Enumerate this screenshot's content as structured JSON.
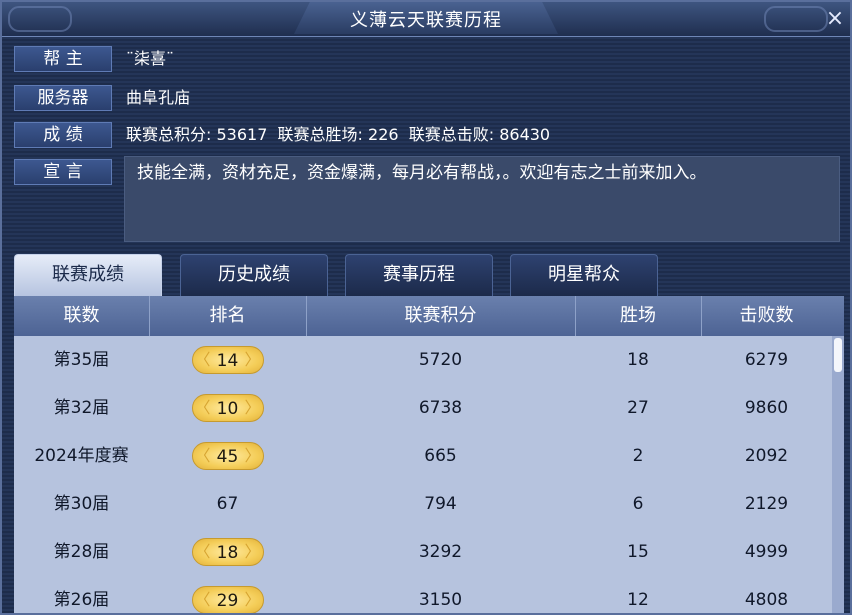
{
  "window": {
    "title": "义薄云天联赛历程",
    "close_icon": "×"
  },
  "info": {
    "leader_label": "帮 主",
    "leader_value": "¨柒喜¨",
    "server_label": "服务器",
    "server_value": "曲阜孔庙",
    "score_label": "成 绩",
    "score_value": "联赛总积分: 53617  联赛总胜场: 226  联赛总击败: 86430",
    "declaration_label": "宣 言",
    "declaration_value": "技能全满，资材充足，资金爆满，每月必有帮战，。欢迎有志之士前来加入。"
  },
  "tabs": [
    {
      "label": "联赛成绩",
      "active": true
    },
    {
      "label": "历史成绩",
      "active": false
    },
    {
      "label": "赛事历程",
      "active": false
    },
    {
      "label": "明星帮众",
      "active": false
    }
  ],
  "table": {
    "headers": [
      "联数",
      "排名",
      "联赛积分",
      "胜场",
      "击败数"
    ],
    "rows": [
      {
        "season": "第35届",
        "rank": "14",
        "highlight": true,
        "points": "5720",
        "wins": "18",
        "kills": "6279"
      },
      {
        "season": "第32届",
        "rank": "10",
        "highlight": true,
        "points": "6738",
        "wins": "27",
        "kills": "9860"
      },
      {
        "season": "2024年度赛",
        "rank": "45",
        "highlight": true,
        "points": "665",
        "wins": "2",
        "kills": "2092"
      },
      {
        "season": "第30届",
        "rank": "67",
        "highlight": false,
        "points": "794",
        "wins": "6",
        "kills": "2129"
      },
      {
        "season": "第28届",
        "rank": "18",
        "highlight": true,
        "points": "3292",
        "wins": "15",
        "kills": "4999"
      },
      {
        "season": "第26届",
        "rank": "29",
        "highlight": true,
        "points": "3150",
        "wins": "12",
        "kills": "4808"
      }
    ]
  }
}
